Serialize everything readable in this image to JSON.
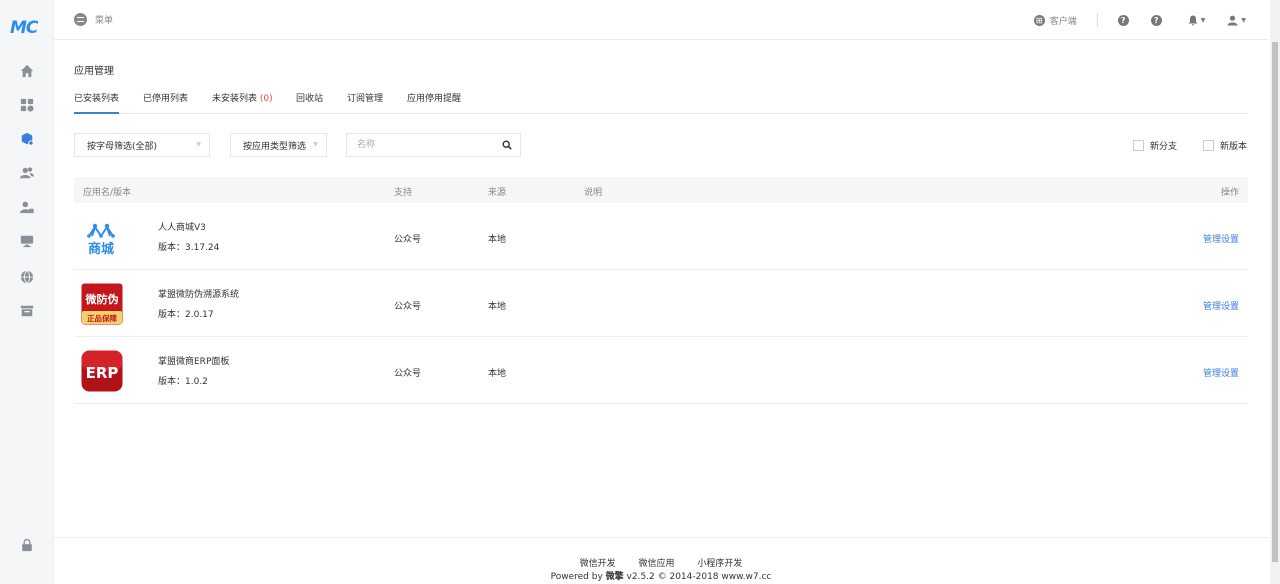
{
  "brand": {
    "logo_text": "MC"
  },
  "sidebar": {
    "items": [
      {
        "name": "home-icon"
      },
      {
        "name": "apps-grid-icon"
      },
      {
        "name": "app-manage-icon"
      },
      {
        "name": "users-icon"
      },
      {
        "name": "user-lock-icon"
      },
      {
        "name": "monitor-icon"
      },
      {
        "name": "globe-icon"
      },
      {
        "name": "store-icon"
      },
      {
        "name": "lock-icon"
      }
    ]
  },
  "header": {
    "menu_label": "菜单",
    "client_label": "客户端",
    "help_label": "?"
  },
  "page": {
    "title": "应用管理"
  },
  "tabs": [
    {
      "label": "已安装列表"
    },
    {
      "label": "已停用列表"
    },
    {
      "label": "未安装列表",
      "count": "(0)"
    },
    {
      "label": "回收站"
    },
    {
      "label": "订阅管理"
    },
    {
      "label": "应用停用提醒"
    }
  ],
  "filters": {
    "letter_filter": "按字母筛选(全部)",
    "type_filter": "按应用类型筛选",
    "search_placeholder": "名称",
    "new_branch": "新分支",
    "new_version": "新版本"
  },
  "table": {
    "headers": {
      "name": "应用名/版本",
      "support": "支持",
      "source": "来源",
      "desc": "说明",
      "action": "操作"
    },
    "rows": [
      {
        "name": "人人商城V3",
        "version": "版本：3.17.24",
        "support": "公众号",
        "source": "本地",
        "action": "管理设置",
        "icon": "renren-mall-logo",
        "icon_text": "商城"
      },
      {
        "name": "掌盟微防伪溯源系统",
        "version": "版本：2.0.17",
        "support": "公众号",
        "source": "本地",
        "action": "管理设置",
        "icon": "anti-fake-logo",
        "icon_text": "微防伪",
        "icon_sub": "正品保障"
      },
      {
        "name": "掌盟微商ERP面板",
        "version": "版本：1.0.2",
        "support": "公众号",
        "source": "本地",
        "action": "管理设置",
        "icon": "erp-logo",
        "icon_text": "ERP"
      }
    ]
  },
  "footer": {
    "links": [
      "微信开发",
      "微信应用",
      "小程序开发"
    ],
    "copyright_prefix": "Powered by ",
    "copyright_brand": "微擎",
    "copyright_suffix": " v2.5.2 © 2014-2018 www.w7.cc"
  },
  "colors": {
    "accent": "#3c7edb",
    "danger": "#e54d42",
    "erp_red": "#c4161c",
    "mall_blue": "#2d8cf0"
  }
}
